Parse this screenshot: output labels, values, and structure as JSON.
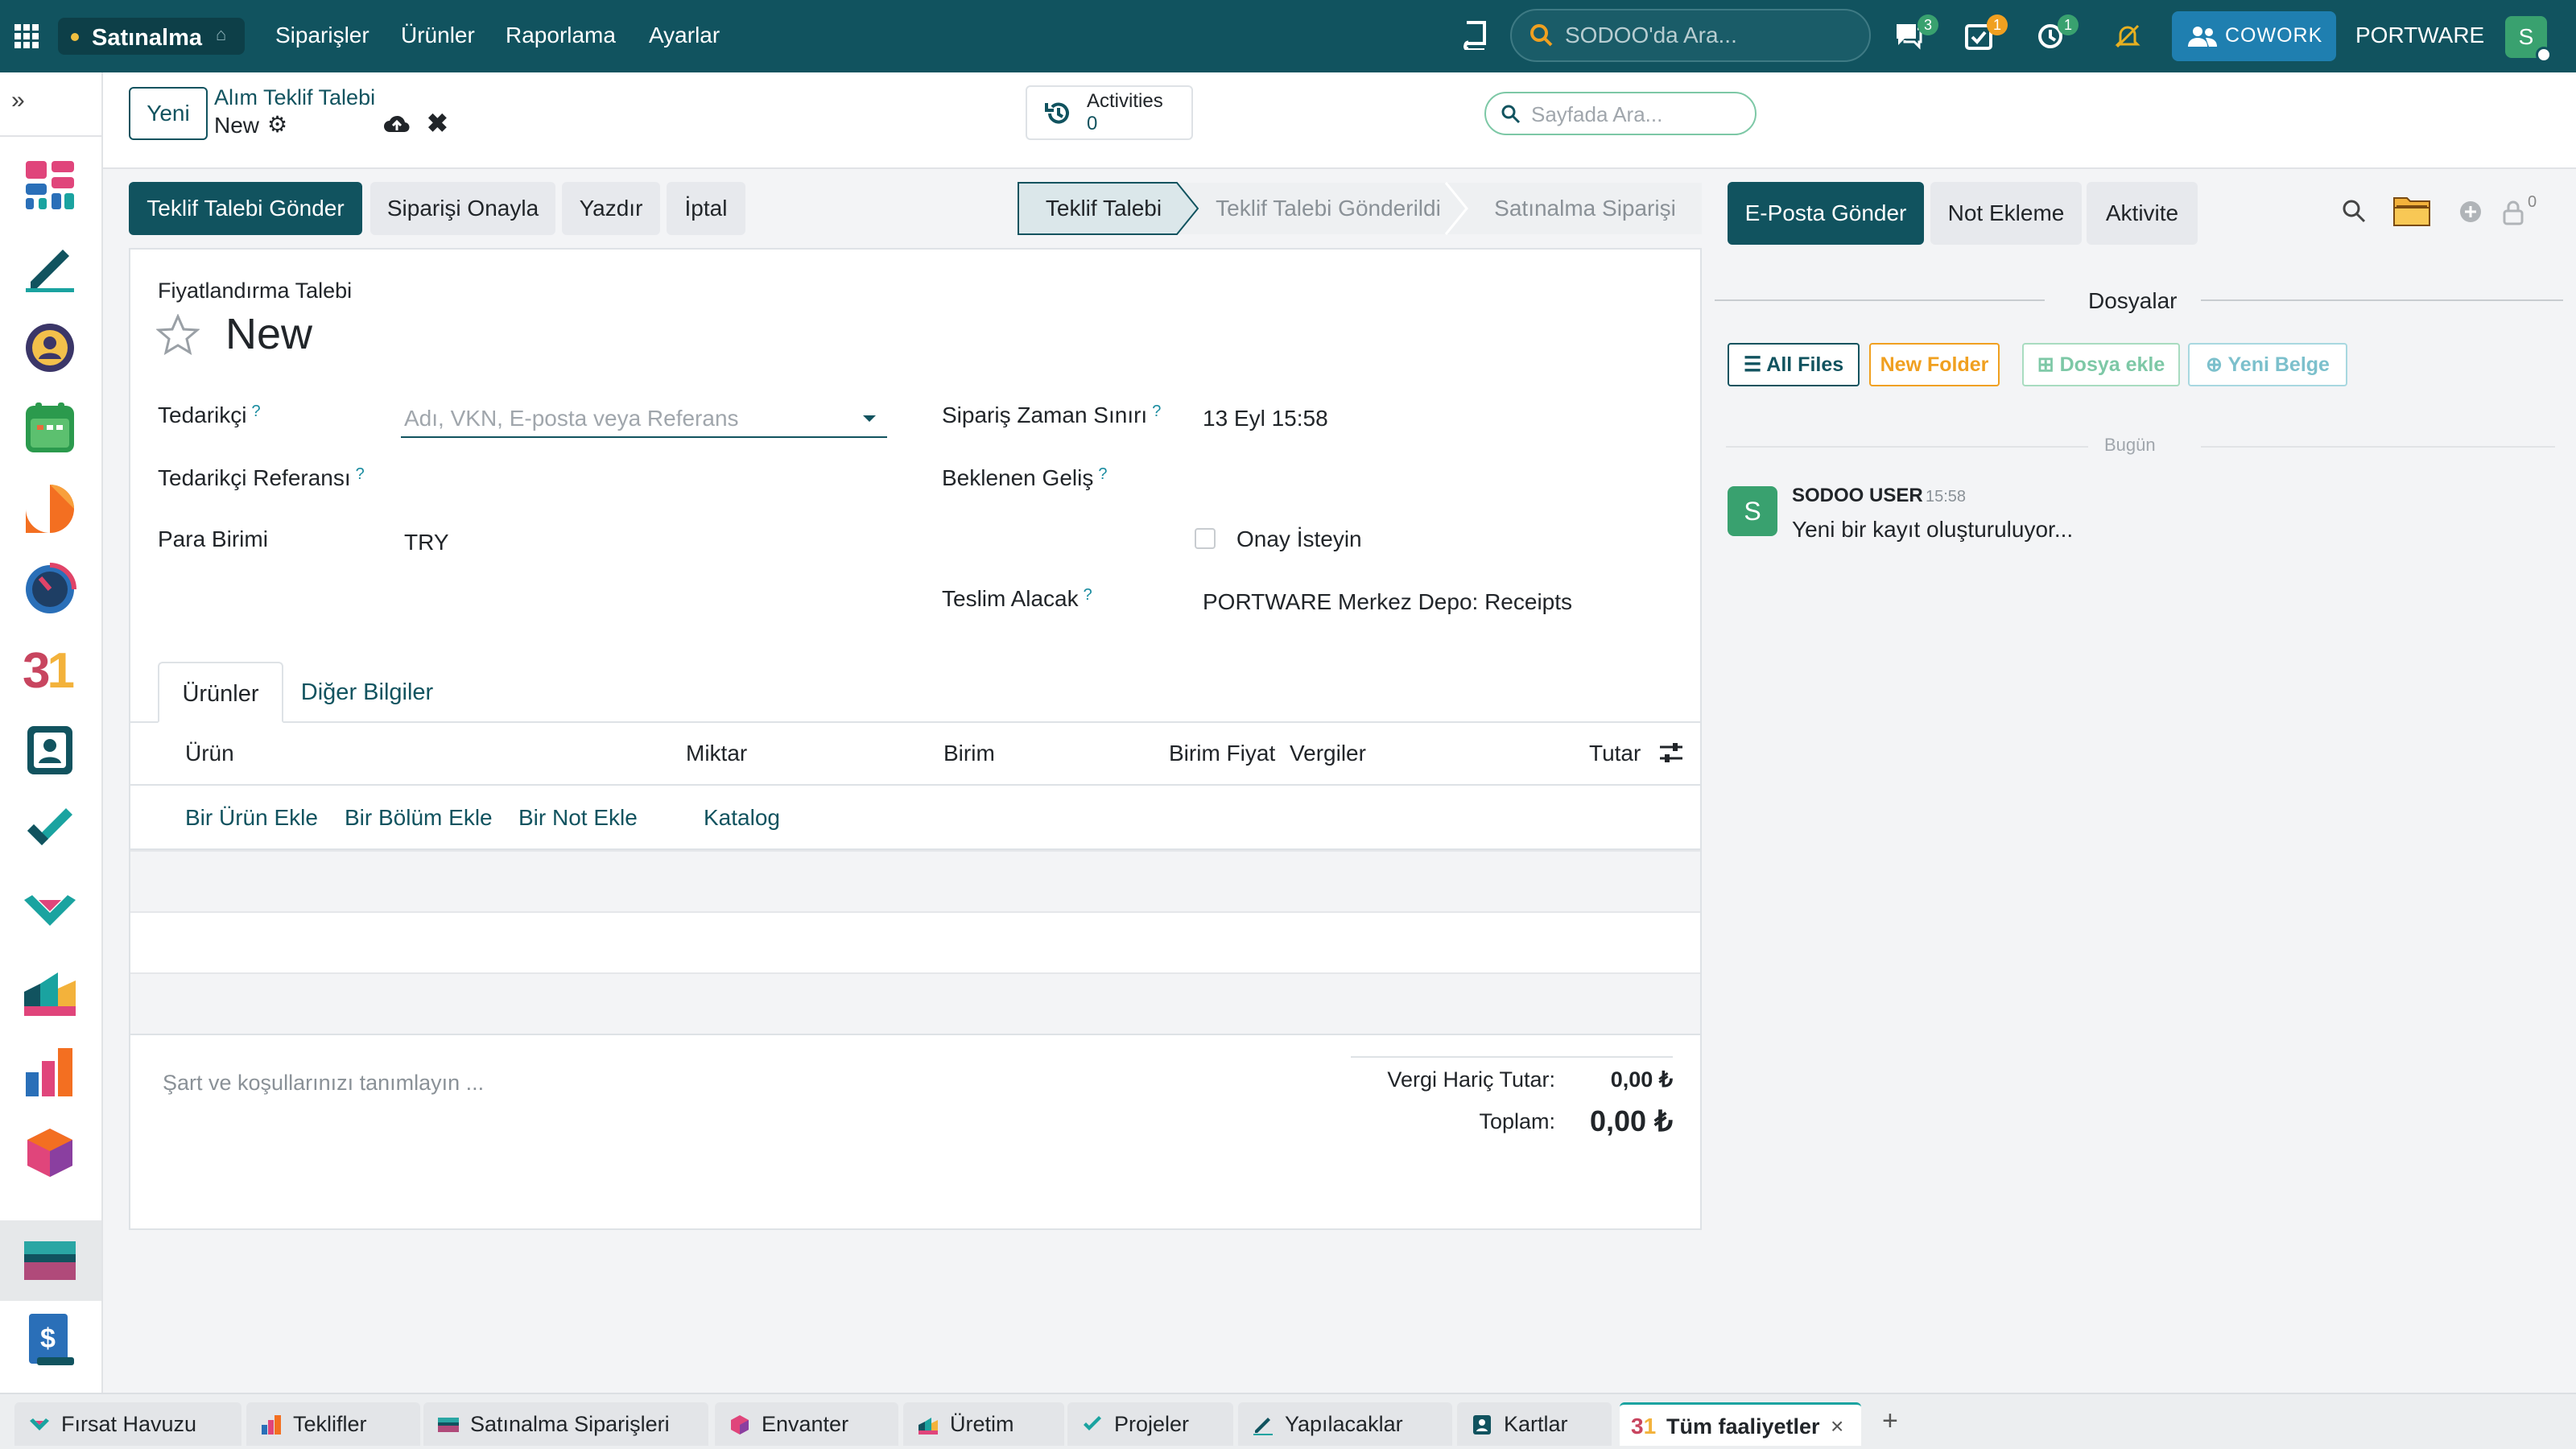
{
  "topbar": {
    "app_name": "Satınalma",
    "menu": [
      "Siparişler",
      "Ürünler",
      "Raporlama",
      "Ayarlar"
    ],
    "search_placeholder": "SODOO'da Ara...",
    "badges": {
      "messages": "3",
      "activities": "1",
      "timer": "1"
    },
    "cowork_label": "COWORK",
    "company": "PORTWARE",
    "avatar_letter": "S"
  },
  "control": {
    "new_button": "Yeni",
    "breadcrumb_parent": "Alım Teklif Talebi",
    "breadcrumb_current": "New",
    "activities_label": "Activities",
    "activities_count": "0",
    "page_search_placeholder": "Sayfada Ara..."
  },
  "actions": {
    "send_rfq": "Teklif Talebi Gönder",
    "confirm_order": "Siparişi Onayla",
    "print": "Yazdır",
    "cancel": "İptal"
  },
  "status_stages": [
    "Teklif Talebi",
    "Teklif Talebi Gönderildi",
    "Satınalma Siparişi"
  ],
  "form": {
    "doc_type": "Fiyatlandırma Talebi",
    "name": "New",
    "labels": {
      "vendor": "Tedarikçi",
      "vendor_ref": "Tedarikçi Referansı",
      "currency": "Para Birimi",
      "order_deadline": "Sipariş Zaman Sınırı",
      "expected_arrival": "Beklenen Geliş",
      "ask_confirmation": "Onay İsteyin",
      "deliver_to": "Teslim Alacak"
    },
    "values": {
      "vendor_placeholder": "Adı, VKN, E-posta veya Referans",
      "currency": "TRY",
      "order_deadline": "13 Eyl 15:58",
      "deliver_to": "PORTWARE Merkez Depo: Receipts"
    },
    "help_mark": "?"
  },
  "tabs": [
    "Ürünler",
    "Diğer Bilgiler"
  ],
  "lines_table": {
    "headers": [
      "Ürün",
      "Miktar",
      "Birim",
      "Birim Fiyat",
      "Vergiler",
      "Tutar"
    ],
    "add_links": [
      "Bir Ürün Ekle",
      "Bir Bölüm Ekle",
      "Bir Not Ekle",
      "Katalog"
    ]
  },
  "totals": {
    "terms_placeholder": "Şart ve koşullarınızı tanımlayın ...",
    "untaxed_label": "Vergi Hariç Tutar:",
    "untaxed_value": "0,00 ₺",
    "total_label": "Toplam:",
    "total_value": "0,00 ₺"
  },
  "chatter": {
    "send_email": "E-Posta Gönder",
    "log_note": "Not Ekleme",
    "activity": "Aktivite",
    "followers_count": "0",
    "files_title": "Dosyalar",
    "file_buttons": [
      "All Files",
      "New Folder",
      "Dosya ekle",
      "Yeni Belge"
    ],
    "date_separator": "Bugün",
    "message": {
      "author": "SODOO USER",
      "time": "15:58",
      "body": "Yeni bir kayıt oluşturuluyor...",
      "avatar": "S"
    }
  },
  "bottom_tabs": [
    "Fırsat Havuzu",
    "Teklifler",
    "Satınalma Siparişleri",
    "Envanter",
    "Üretim",
    "Projeler",
    "Yapılacaklar",
    "Kartlar",
    "Tüm faaliyetler"
  ],
  "colors": {
    "brand": "#11535f",
    "accent": "#1a8ca0",
    "success": "#39a16f",
    "warning": "#f0a020"
  }
}
